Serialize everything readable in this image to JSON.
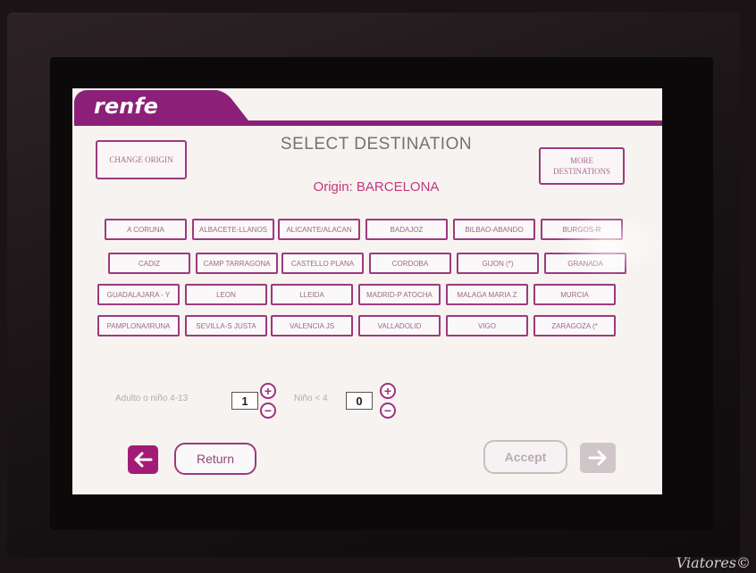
{
  "brand": {
    "logo": "renfe"
  },
  "header": {
    "title": "SELECT DESTINATION",
    "origin_label": "Origin:",
    "origin_city": "BARCELONA",
    "change_origin": "CHANGE ORIGIN",
    "more_destinations": "MORE DESTINATIONS"
  },
  "destinations": [
    "A CORUNA",
    "ALBACETE-LLANOS",
    "ALICANTE/ALACAN",
    "BADAJOZ",
    "BILBAO-ABANDO",
    "BURGOS-R",
    "CADIZ",
    "CAMP TARRAGONA",
    "CASTELLO PLANA",
    "CORDOBA",
    "GIJON (*)",
    "GRANADA",
    "GUADALAJARA - Y",
    "LEON",
    "LLEIDA",
    "MADRID-P ATOCHA",
    "MALAGA MARIA Z",
    "MURCIA",
    "PAMPLONA/IRUNA",
    "SEVILLA-S JUSTA",
    "VALENCIA JS",
    "VALLADOLID",
    "VIGO",
    "ZARAGOZA (*"
  ],
  "passengers": {
    "adult_label": "Adulto o niño 4-13",
    "adult_count": "1",
    "child_label": "Niño < 4",
    "child_count": "0",
    "plus": "+",
    "minus": "−"
  },
  "footer": {
    "return_label": "Return",
    "accept_label": "Accept"
  },
  "colors": {
    "brand": "#8c1f78",
    "accent": "#a3307c"
  },
  "watermark": "Viatores©"
}
